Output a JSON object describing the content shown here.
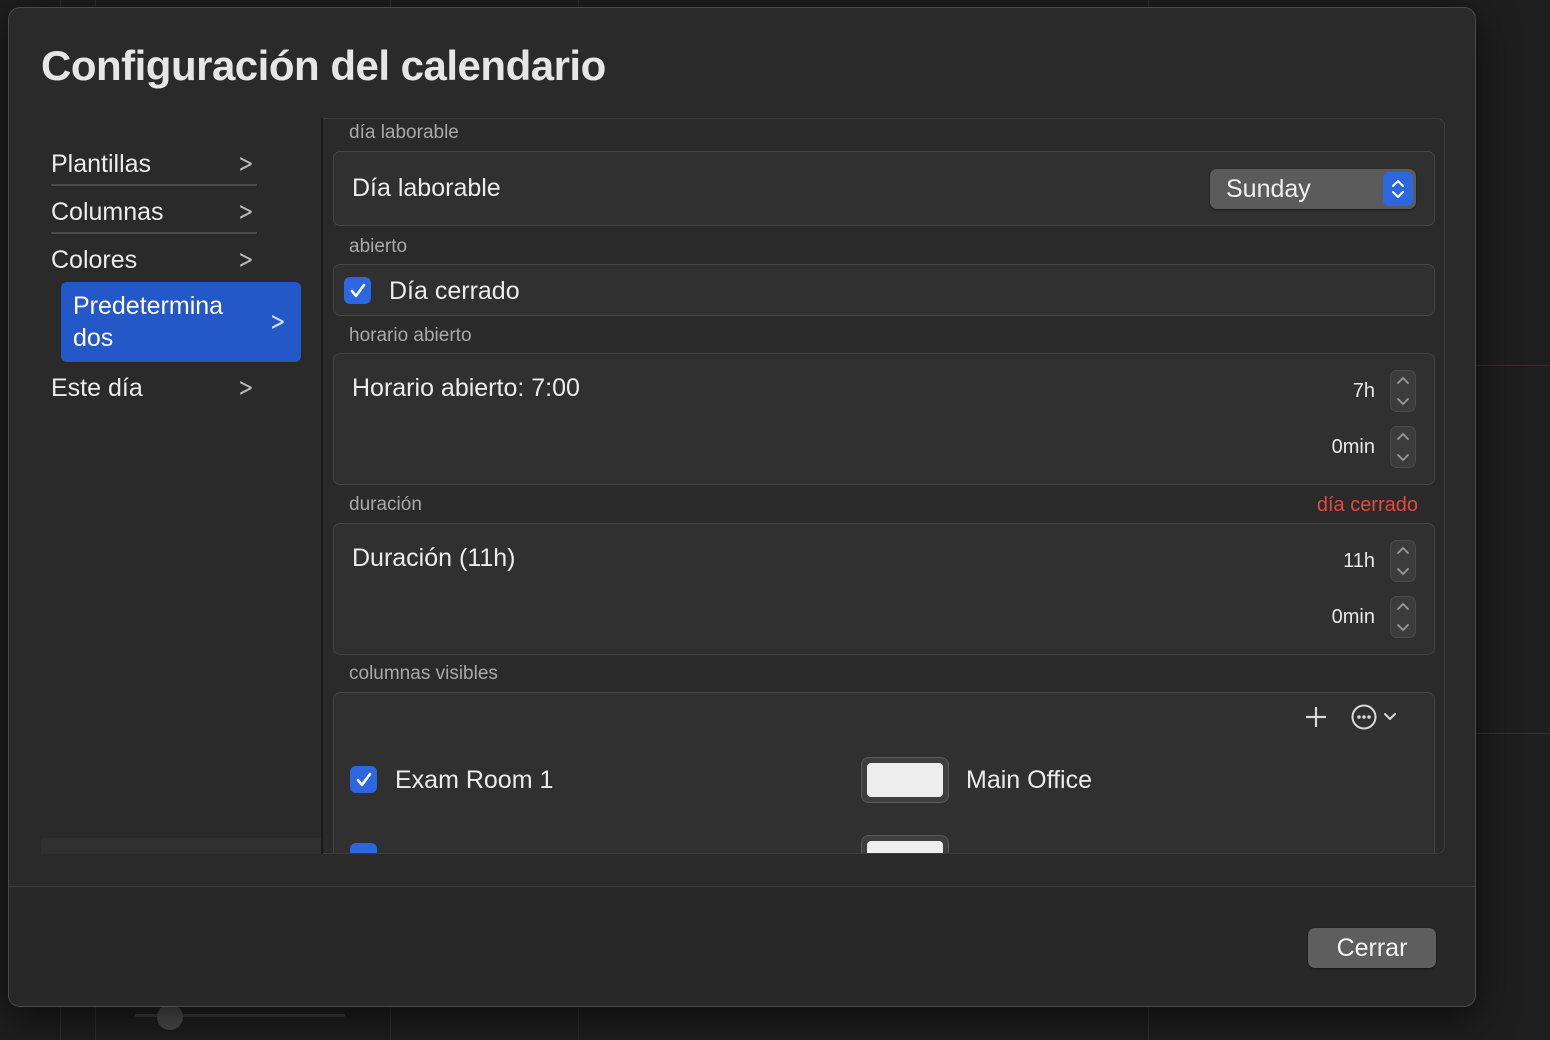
{
  "window": {
    "title": "Configuración del calendario"
  },
  "sidebar": {
    "items": [
      {
        "label": "Plantillas"
      },
      {
        "label": "Columnas"
      },
      {
        "label": "Colores"
      },
      {
        "label": "Predetermina\ndos",
        "selected": true
      },
      {
        "label": "Este día"
      }
    ]
  },
  "sections": {
    "workday": {
      "header": "día laborable",
      "label": "Día laborable",
      "popup_value": "Sunday"
    },
    "open": {
      "header": "abierto",
      "checkbox_label": "Día cerrado",
      "checked": true
    },
    "open_hours": {
      "header": "horario abierto",
      "label": "Horario abierto: 7:00",
      "hours_value": "7h",
      "minutes_value": "0min"
    },
    "duration": {
      "header": "duración",
      "warning": "día cerrado",
      "label": "Duración (11h)",
      "hours_value": "11h",
      "minutes_value": "0min"
    },
    "visible_columns": {
      "header": "columnas visibles",
      "rows": [
        {
          "label": "Exam Room 1",
          "checked": true,
          "location": "Main Office"
        }
      ]
    }
  },
  "footer": {
    "close_label": "Cerrar"
  },
  "colors": {
    "accent": "#2c67e0",
    "selection": "#2458c9",
    "warning": "#e24a3e"
  }
}
